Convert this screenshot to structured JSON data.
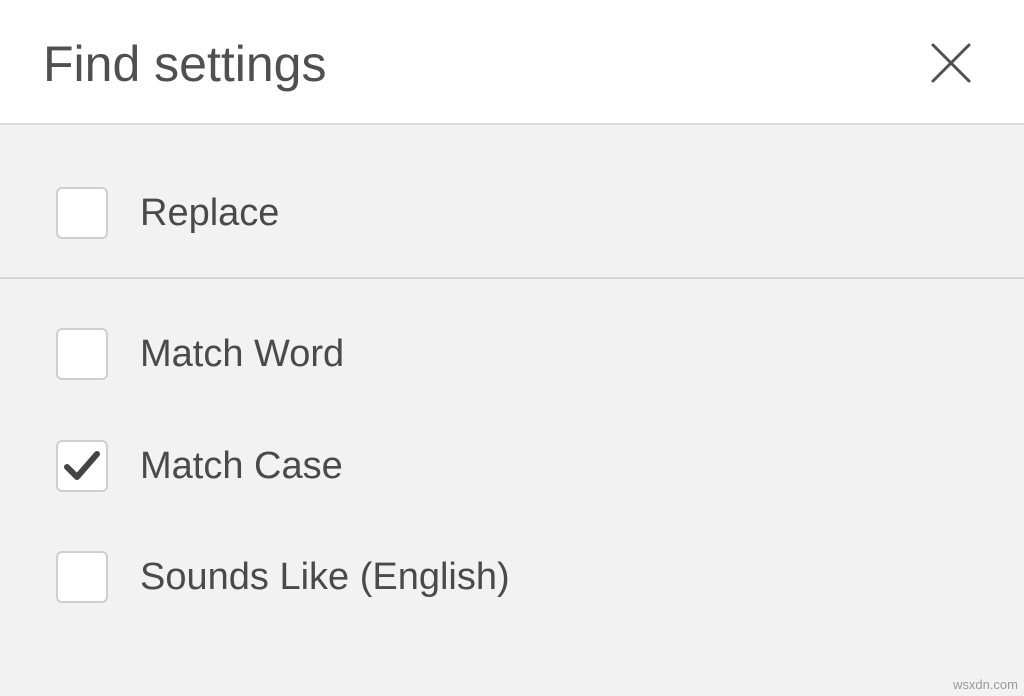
{
  "header": {
    "title": "Find settings",
    "close_icon": "close-icon"
  },
  "options": [
    {
      "label": "Replace",
      "checked": false
    },
    {
      "label": "Match Word",
      "checked": false
    },
    {
      "label": "Match Case",
      "checked": true
    },
    {
      "label": "Sounds Like (English)",
      "checked": false
    }
  ],
  "watermark": "wsxdn.com",
  "colors": {
    "header_bg": "#ffffff",
    "body_bg": "#f2f2f2",
    "text": "#4a4a4a",
    "checkbox_border": "#cfcfcf",
    "checkmark": "#444444"
  }
}
